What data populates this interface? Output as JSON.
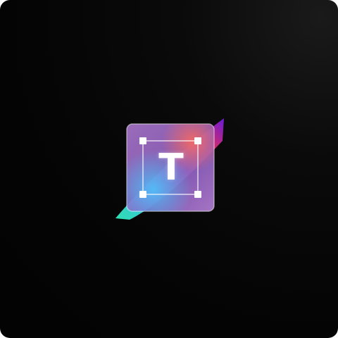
{
  "app_icon": {
    "name": "text-tool-app-icon",
    "glyph": "T",
    "icon": "text-selection-icon",
    "colors": {
      "background": "#050505",
      "tile_purple": "#b07ad0",
      "accent_blue": "#3fb4f0",
      "accent_teal": "#2ee0b0",
      "accent_red": "#f0304a",
      "accent_violet": "#6a1ad8",
      "handle_color": "#ffffff"
    }
  }
}
